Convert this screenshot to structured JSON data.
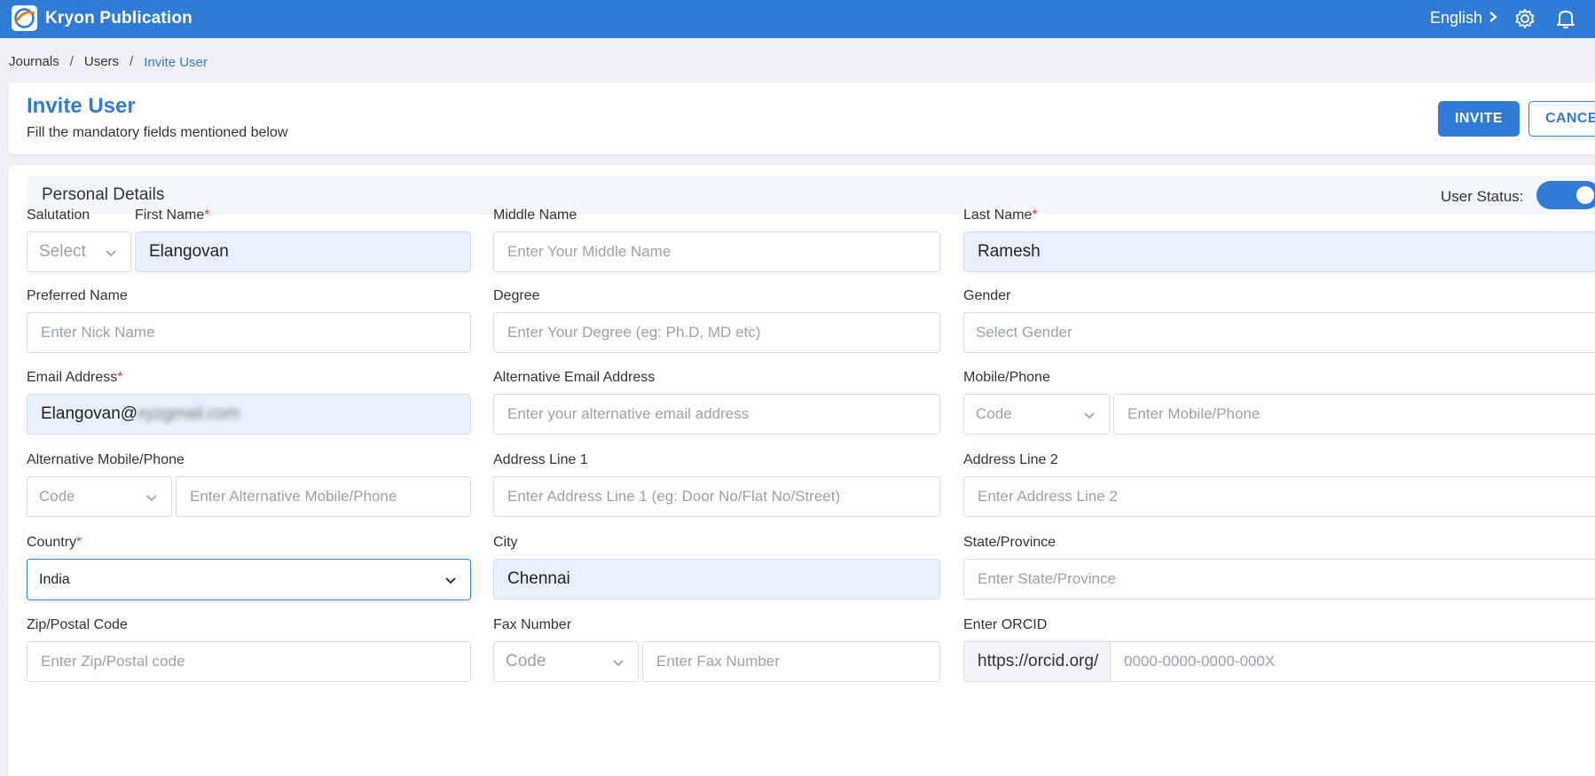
{
  "app": {
    "title": "Kryon Publication",
    "language": "English",
    "accent": "#2f7bd6"
  },
  "breadcrumb": {
    "items": [
      "Journals",
      "Users"
    ],
    "current": "Invite User",
    "separator": "/"
  },
  "header": {
    "title": "Invite User",
    "subtitle": "Fill the mandatory fields mentioned below",
    "invite_label": "INVITE",
    "cancel_label": "CANCE"
  },
  "section": {
    "title": "Personal Details",
    "status_label": "User Status:",
    "status_on": true
  },
  "required_mark": "*",
  "fields": {
    "salutation": {
      "label": "Salutation",
      "placeholder": "Select"
    },
    "first_name": {
      "label": "First Name",
      "value": "Elangovan"
    },
    "middle_name": {
      "label": "Middle Name",
      "placeholder": "Enter Your Middle Name"
    },
    "last_name": {
      "label": "Last Name",
      "value": "Ramesh"
    },
    "preferred_name": {
      "label": "Preferred Name",
      "placeholder": "Enter Nick Name"
    },
    "degree": {
      "label": "Degree",
      "placeholder": "Enter Your Degree (eg: Ph.D, MD etc)"
    },
    "gender": {
      "label": "Gender",
      "placeholder": "Select Gender"
    },
    "email": {
      "label": "Email Address",
      "value_visible": "Elangovan@",
      "value_blurred": "xyzgmail.com"
    },
    "alt_email": {
      "label": "Alternative Email Address",
      "placeholder": "Enter your alternative email address"
    },
    "mobile": {
      "label": "Mobile/Phone",
      "code_placeholder": "Code",
      "placeholder": "Enter Mobile/Phone"
    },
    "alt_mobile": {
      "label": "Alternative Mobile/Phone",
      "code_placeholder": "Code",
      "placeholder": "Enter Alternative Mobile/Phone"
    },
    "address1": {
      "label": "Address Line 1",
      "placeholder": "Enter Address Line 1 (eg: Door No/Flat No/Street)"
    },
    "address2": {
      "label": "Address Line 2",
      "placeholder": "Enter Address Line 2"
    },
    "country": {
      "label": "Country",
      "value": "India"
    },
    "city": {
      "label": "City",
      "value": "Chennai"
    },
    "state": {
      "label": "State/Province",
      "placeholder": "Enter State/Province"
    },
    "zip": {
      "label": "Zip/Postal Code",
      "placeholder": "Enter Zip/Postal code"
    },
    "fax": {
      "label": "Fax Number",
      "code_placeholder": "Code",
      "placeholder": "Enter Fax Number"
    },
    "orcid": {
      "label": "Enter ORCID",
      "prefix": "https://orcid.org/",
      "placeholder": "0000-0000-0000-000X"
    }
  }
}
